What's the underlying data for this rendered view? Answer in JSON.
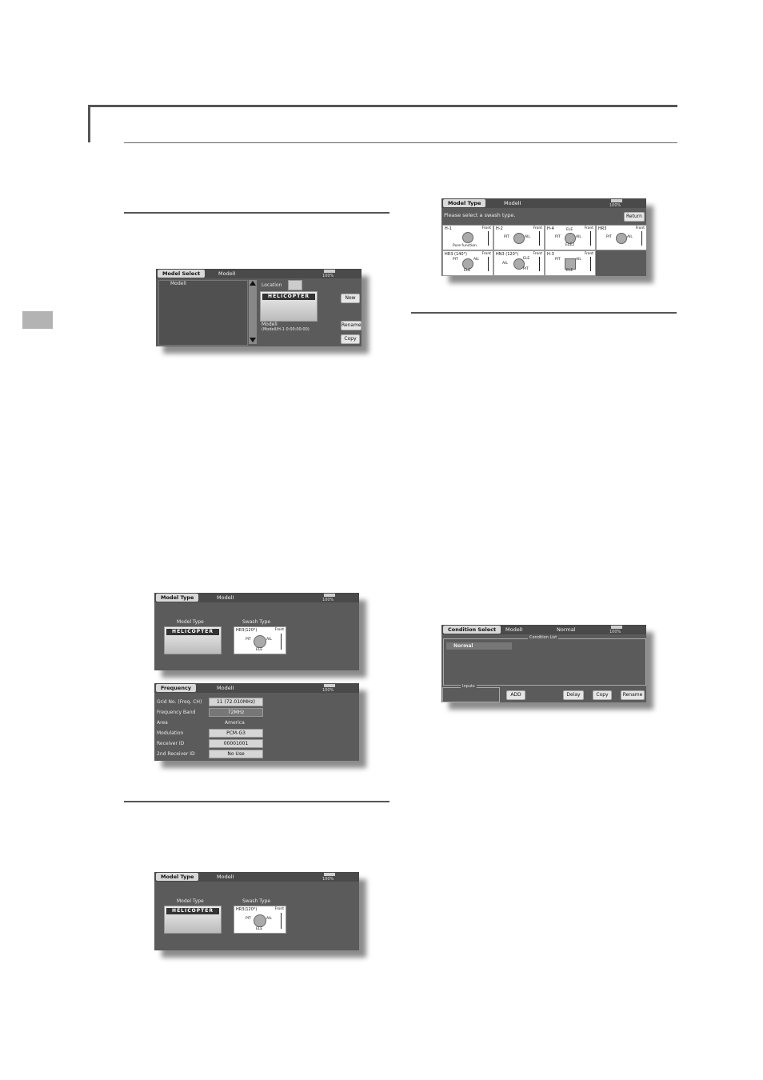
{
  "colors": {
    "screen_bg": "#5b5b5b",
    "rule": "#555555",
    "side_tab": "#b3b3b3"
  },
  "model_select": {
    "tab": "Model Select",
    "model": "ModelI",
    "list_item": "ModelI",
    "location_label": "Location",
    "image_text": "HELICOPTER",
    "info_name": "ModelI",
    "info_sub": "(ModelI/H-1 0:00:00:00)",
    "buttons": {
      "new": "New",
      "rename": "Rename",
      "copy": "Copy"
    },
    "battery": "100%"
  },
  "model_type_1": {
    "tab": "Model Type",
    "model": "ModelI",
    "model_type_label": "Model Type",
    "swash_type_label": "Swash Type",
    "image_text": "HELICOPTER",
    "swash_name": "HR3(120°)",
    "front": "Front",
    "pit": "PIT",
    "ail": "AIL",
    "ele": "ELE",
    "battery": "100%"
  },
  "frequency": {
    "tab": "Frequency",
    "model": "ModelI",
    "battery": "100%",
    "rows": [
      {
        "label": "Grid No. (Freq. CH)",
        "value": "11 (72.010MHz)"
      },
      {
        "label": "Frequency Band",
        "value": "72MHz"
      },
      {
        "label": "Area",
        "value": "America"
      },
      {
        "label": "Modulation",
        "value": "PCM-G3"
      },
      {
        "label": "Receiver ID",
        "value": "00001001"
      },
      {
        "label": "2nd Receiver ID",
        "value": "No Use"
      }
    ]
  },
  "model_type_2": {
    "tab": "Model Type",
    "model": "ModelI",
    "model_type_label": "Model Type",
    "swash_type_label": "Swash Type",
    "image_text": "HELICOPTER",
    "swash_name": "HR3(120°)",
    "front": "Front",
    "pit": "PIT",
    "ail": "AIL",
    "ele": "ELE",
    "battery": "100%"
  },
  "swash_select": {
    "tab": "Model Type",
    "model": "ModelI",
    "prompt": "Please select a swash type.",
    "return": "Return",
    "battery": "100%",
    "types": [
      {
        "name": "H-1",
        "labels": [
          "Pure function"
        ]
      },
      {
        "name": "H-2",
        "labels": [
          "PIT",
          "AIL"
        ]
      },
      {
        "name": "H-4",
        "labels": [
          "ELE",
          "PIT",
          "AIL",
          "ELE2"
        ]
      },
      {
        "name": "HR3",
        "labels": [
          "PIT",
          "AIL"
        ]
      },
      {
        "name": "HR3 (140°)",
        "labels": [
          "PIT",
          "AIL",
          "ELE"
        ]
      },
      {
        "name": "HN3 (120°)",
        "labels": [
          "ELE",
          "AIL",
          "PIT"
        ]
      },
      {
        "name": "H-3",
        "labels": [
          "PIT",
          "AIL",
          "ELE"
        ]
      }
    ],
    "front": "Front"
  },
  "condition_select": {
    "tab": "Condition Select",
    "model": "ModelI",
    "condition": "Normal",
    "battery": "100%",
    "list_title": "Condition List",
    "item": "Normal",
    "inputs_label": "Inputs",
    "buttons": {
      "add": "ADD",
      "delay": "Delay",
      "copy": "Copy",
      "rename": "Rename"
    }
  }
}
